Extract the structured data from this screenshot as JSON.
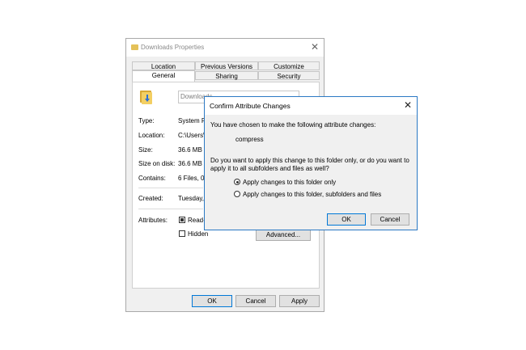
{
  "back_window": {
    "title": "Downloads Properties",
    "tabs_row1": [
      "Location",
      "Previous Versions",
      "Customize"
    ],
    "tabs_row2": [
      "General",
      "Sharing",
      "Security"
    ],
    "name_field_value": "Downloads",
    "properties": [
      {
        "label": "Type:",
        "value": "System Fo"
      },
      {
        "label": "Location:",
        "value": "C:\\Users\\"
      },
      {
        "label": "Size:",
        "value": "36.6 MB ("
      },
      {
        "label": "Size on disk:",
        "value": "36.6 MB ("
      },
      {
        "label": "Contains:",
        "value": "6 Files, 0"
      },
      {
        "label": "Created:",
        "value": "Tuesday, A"
      }
    ],
    "attributes_label": "Attributes:",
    "attr_readonly": "Read-o",
    "attr_hidden": "Hidden",
    "advanced_button": "Advanced...",
    "ok_button": "OK",
    "cancel_button": "Cancel",
    "apply_button": "Apply"
  },
  "dialog": {
    "title": "Confirm Attribute Changes",
    "line1": "You have chosen to make the following attribute changes:",
    "change": "compress",
    "question_line1": "Do you want to apply this change to this folder only, or do you want to",
    "question_line2": "apply it to all subfolders and files as well?",
    "radio_option1": "Apply changes to this folder only",
    "radio_option2": "Apply changes to this folder, subfolders and files",
    "selected_option": 1,
    "ok_button": "OK",
    "cancel_button": "Cancel"
  }
}
